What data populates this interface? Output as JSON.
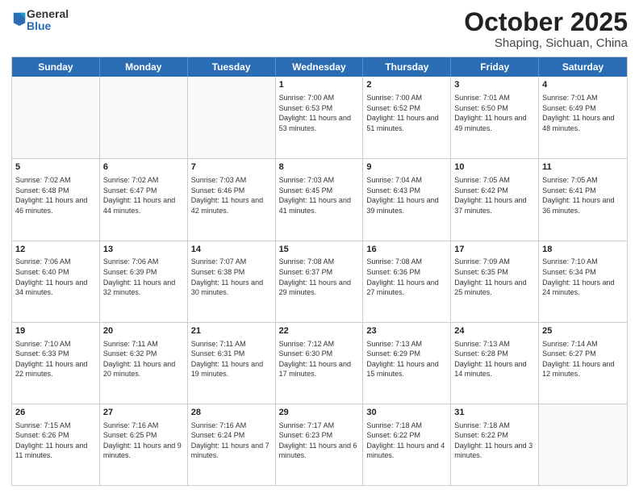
{
  "header": {
    "logo": {
      "general": "General",
      "blue": "Blue"
    },
    "title": "October 2025",
    "subtitle": "Shaping, Sichuan, China"
  },
  "days": [
    "Sunday",
    "Monday",
    "Tuesday",
    "Wednesday",
    "Thursday",
    "Friday",
    "Saturday"
  ],
  "rows": [
    [
      {
        "day": "",
        "empty": true,
        "text": ""
      },
      {
        "day": "",
        "empty": true,
        "text": ""
      },
      {
        "day": "",
        "empty": true,
        "text": ""
      },
      {
        "day": "1",
        "empty": false,
        "text": "Sunrise: 7:00 AM\nSunset: 6:53 PM\nDaylight: 11 hours and 53 minutes."
      },
      {
        "day": "2",
        "empty": false,
        "text": "Sunrise: 7:00 AM\nSunset: 6:52 PM\nDaylight: 11 hours and 51 minutes."
      },
      {
        "day": "3",
        "empty": false,
        "text": "Sunrise: 7:01 AM\nSunset: 6:50 PM\nDaylight: 11 hours and 49 minutes."
      },
      {
        "day": "4",
        "empty": false,
        "text": "Sunrise: 7:01 AM\nSunset: 6:49 PM\nDaylight: 11 hours and 48 minutes."
      }
    ],
    [
      {
        "day": "5",
        "empty": false,
        "text": "Sunrise: 7:02 AM\nSunset: 6:48 PM\nDaylight: 11 hours and 46 minutes."
      },
      {
        "day": "6",
        "empty": false,
        "text": "Sunrise: 7:02 AM\nSunset: 6:47 PM\nDaylight: 11 hours and 44 minutes."
      },
      {
        "day": "7",
        "empty": false,
        "text": "Sunrise: 7:03 AM\nSunset: 6:46 PM\nDaylight: 11 hours and 42 minutes."
      },
      {
        "day": "8",
        "empty": false,
        "text": "Sunrise: 7:03 AM\nSunset: 6:45 PM\nDaylight: 11 hours and 41 minutes."
      },
      {
        "day": "9",
        "empty": false,
        "text": "Sunrise: 7:04 AM\nSunset: 6:43 PM\nDaylight: 11 hours and 39 minutes."
      },
      {
        "day": "10",
        "empty": false,
        "text": "Sunrise: 7:05 AM\nSunset: 6:42 PM\nDaylight: 11 hours and 37 minutes."
      },
      {
        "day": "11",
        "empty": false,
        "text": "Sunrise: 7:05 AM\nSunset: 6:41 PM\nDaylight: 11 hours and 36 minutes."
      }
    ],
    [
      {
        "day": "12",
        "empty": false,
        "text": "Sunrise: 7:06 AM\nSunset: 6:40 PM\nDaylight: 11 hours and 34 minutes."
      },
      {
        "day": "13",
        "empty": false,
        "text": "Sunrise: 7:06 AM\nSunset: 6:39 PM\nDaylight: 11 hours and 32 minutes."
      },
      {
        "day": "14",
        "empty": false,
        "text": "Sunrise: 7:07 AM\nSunset: 6:38 PM\nDaylight: 11 hours and 30 minutes."
      },
      {
        "day": "15",
        "empty": false,
        "text": "Sunrise: 7:08 AM\nSunset: 6:37 PM\nDaylight: 11 hours and 29 minutes."
      },
      {
        "day": "16",
        "empty": false,
        "text": "Sunrise: 7:08 AM\nSunset: 6:36 PM\nDaylight: 11 hours and 27 minutes."
      },
      {
        "day": "17",
        "empty": false,
        "text": "Sunrise: 7:09 AM\nSunset: 6:35 PM\nDaylight: 11 hours and 25 minutes."
      },
      {
        "day": "18",
        "empty": false,
        "text": "Sunrise: 7:10 AM\nSunset: 6:34 PM\nDaylight: 11 hours and 24 minutes."
      }
    ],
    [
      {
        "day": "19",
        "empty": false,
        "text": "Sunrise: 7:10 AM\nSunset: 6:33 PM\nDaylight: 11 hours and 22 minutes."
      },
      {
        "day": "20",
        "empty": false,
        "text": "Sunrise: 7:11 AM\nSunset: 6:32 PM\nDaylight: 11 hours and 20 minutes."
      },
      {
        "day": "21",
        "empty": false,
        "text": "Sunrise: 7:11 AM\nSunset: 6:31 PM\nDaylight: 11 hours and 19 minutes."
      },
      {
        "day": "22",
        "empty": false,
        "text": "Sunrise: 7:12 AM\nSunset: 6:30 PM\nDaylight: 11 hours and 17 minutes."
      },
      {
        "day": "23",
        "empty": false,
        "text": "Sunrise: 7:13 AM\nSunset: 6:29 PM\nDaylight: 11 hours and 15 minutes."
      },
      {
        "day": "24",
        "empty": false,
        "text": "Sunrise: 7:13 AM\nSunset: 6:28 PM\nDaylight: 11 hours and 14 minutes."
      },
      {
        "day": "25",
        "empty": false,
        "text": "Sunrise: 7:14 AM\nSunset: 6:27 PM\nDaylight: 11 hours and 12 minutes."
      }
    ],
    [
      {
        "day": "26",
        "empty": false,
        "text": "Sunrise: 7:15 AM\nSunset: 6:26 PM\nDaylight: 11 hours and 11 minutes."
      },
      {
        "day": "27",
        "empty": false,
        "text": "Sunrise: 7:16 AM\nSunset: 6:25 PM\nDaylight: 11 hours and 9 minutes."
      },
      {
        "day": "28",
        "empty": false,
        "text": "Sunrise: 7:16 AM\nSunset: 6:24 PM\nDaylight: 11 hours and 7 minutes."
      },
      {
        "day": "29",
        "empty": false,
        "text": "Sunrise: 7:17 AM\nSunset: 6:23 PM\nDaylight: 11 hours and 6 minutes."
      },
      {
        "day": "30",
        "empty": false,
        "text": "Sunrise: 7:18 AM\nSunset: 6:22 PM\nDaylight: 11 hours and 4 minutes."
      },
      {
        "day": "31",
        "empty": false,
        "text": "Sunrise: 7:18 AM\nSunset: 6:22 PM\nDaylight: 11 hours and 3 minutes."
      },
      {
        "day": "",
        "empty": true,
        "text": ""
      }
    ]
  ]
}
